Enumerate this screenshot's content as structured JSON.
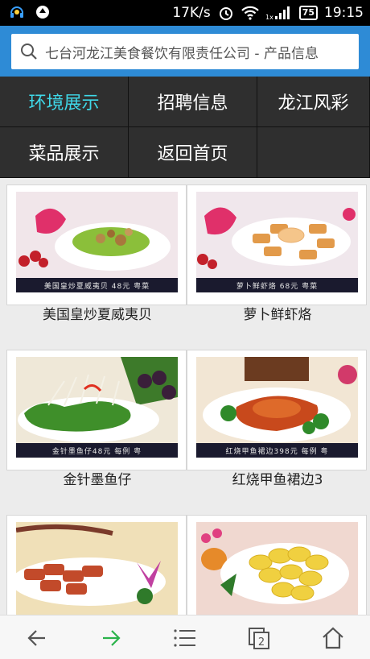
{
  "status": {
    "speed": "17K/s",
    "battery": "75",
    "time": "19:15",
    "signal_prefix": "1x"
  },
  "urlbar": {
    "text": "七台河龙江美食餐饮有限责任公司 - 产品信息"
  },
  "nav": {
    "items": [
      {
        "label": "环境展示",
        "active": true
      },
      {
        "label": "招聘信息",
        "active": false
      },
      {
        "label": "龙江风彩",
        "active": false
      },
      {
        "label": "菜品展示",
        "active": false
      },
      {
        "label": "返回首页",
        "active": false
      }
    ]
  },
  "products": [
    {
      "title": "美国皇炒夏威夷贝",
      "caption": "美国皇炒夏威夷贝 48元 粤菜"
    },
    {
      "title": "萝卜鲜虾烙",
      "caption": "萝卜鲜虾烙 68元 粤菜"
    },
    {
      "title": "金针墨鱼仔",
      "caption": "金针墨鱼仔48元    每例  粤"
    },
    {
      "title": "红烧甲鱼裙边3",
      "caption": "红烧甲鱼裙边398元   每例  粤"
    },
    {
      "title": "",
      "caption": ""
    },
    {
      "title": "",
      "caption": ""
    }
  ],
  "toolbar": {
    "back": "back-arrow-icon",
    "forward": "forward-arrow-icon",
    "menu": "menu-icon",
    "tabs_count": "2",
    "home": "home-icon"
  },
  "colors": {
    "accent": "#2e8bd6",
    "nav_active": "#3fd8e8",
    "forward_green": "#2ab34a"
  }
}
